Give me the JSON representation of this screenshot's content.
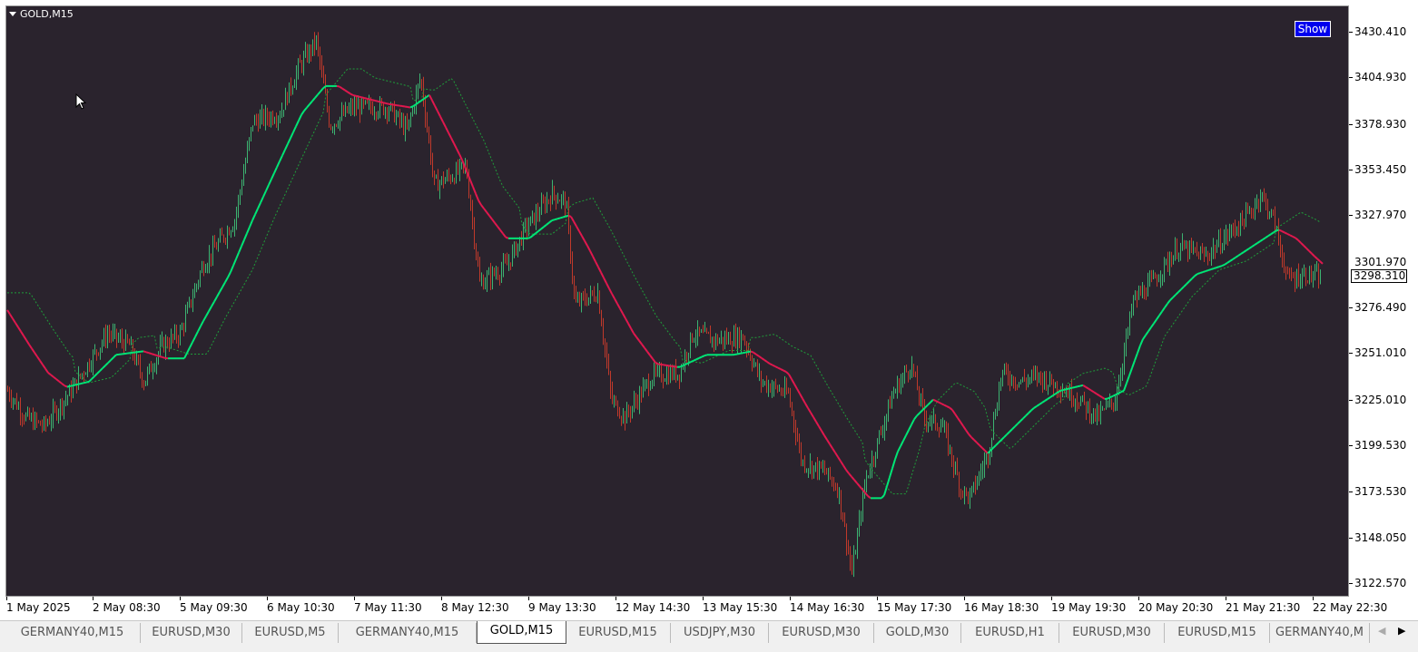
{
  "symbol_title": "GOLD,M15",
  "show_button": "Show",
  "current_price": "3298.310",
  "partial_hidden_label": "3301.970",
  "colors": {
    "background": "#2a232d",
    "bull_candle": "#3cb371",
    "bear_candle": "#c0392b",
    "ma_up": "#00e676",
    "ma_down": "#e0184e",
    "ma_dotted": "#1f9d3a"
  },
  "price_axis": [
    "3430.410",
    "3404.930",
    "3378.930",
    "3353.450",
    "3327.970",
    "3276.490",
    "3251.010",
    "3225.010",
    "3199.530",
    "3173.530",
    "3148.050",
    "3122.570"
  ],
  "time_axis": [
    "1 May 2025",
    "2 May 08:30",
    "5 May 09:30",
    "6 May 10:30",
    "7 May 11:30",
    "8 May 12:30",
    "9 May 13:30",
    "12 May 14:30",
    "13 May 15:30",
    "14 May 16:30",
    "15 May 17:30",
    "16 May 18:30",
    "19 May 19:30",
    "20 May 20:30",
    "21 May 21:30",
    "22 May 22:30"
  ],
  "tabs": [
    "GERMANY40,M15",
    "EURUSD,M30",
    "EURUSD,M5",
    "GERMANY40,M15",
    "GOLD,M15",
    "EURUSD,M15",
    "USDJPY,M30",
    "EURUSD,M30",
    "GOLD,M30",
    "EURUSD,H1",
    "EURUSD,M30",
    "EURUSD,M15",
    "GERMANY40,M"
  ],
  "active_tab": 4,
  "tab_scroll": {
    "left_icon": "scroll-left-icon",
    "right_icon": "scroll-right-icon"
  },
  "chart_data": {
    "type": "candlestick",
    "title": "GOLD,M15",
    "ylim": [
      3115,
      3445
    ],
    "price_path": [
      [
        0,
        3230
      ],
      [
        20,
        3215
      ],
      [
        40,
        3210
      ],
      [
        70,
        3230
      ],
      [
        110,
        3262
      ],
      [
        135,
        3255
      ],
      [
        150,
        3235
      ],
      [
        170,
        3255
      ],
      [
        190,
        3262
      ],
      [
        215,
        3300
      ],
      [
        250,
        3325
      ],
      [
        270,
        3380
      ],
      [
        300,
        3385
      ],
      [
        320,
        3410
      ],
      [
        340,
        3425
      ],
      [
        355,
        3378
      ],
      [
        380,
        3388
      ],
      [
        420,
        3388
      ],
      [
        440,
        3375
      ],
      [
        455,
        3405
      ],
      [
        470,
        3345
      ],
      [
        490,
        3350
      ],
      [
        505,
        3355
      ],
      [
        520,
        3290
      ],
      [
        550,
        3300
      ],
      [
        570,
        3320
      ],
      [
        600,
        3340
      ],
      [
        615,
        3335
      ],
      [
        625,
        3278
      ],
      [
        650,
        3285
      ],
      [
        665,
        3225
      ],
      [
        680,
        3215
      ],
      [
        710,
        3238
      ],
      [
        740,
        3240
      ],
      [
        755,
        3262
      ],
      [
        780,
        3258
      ],
      [
        810,
        3260
      ],
      [
        830,
        3235
      ],
      [
        860,
        3228
      ],
      [
        875,
        3190
      ],
      [
        900,
        3185
      ],
      [
        915,
        3175
      ],
      [
        930,
        3128
      ],
      [
        945,
        3180
      ],
      [
        975,
        3228
      ],
      [
        995,
        3245
      ],
      [
        1010,
        3215
      ],
      [
        1030,
        3210
      ],
      [
        1050,
        3175
      ],
      [
        1060,
        3170
      ],
      [
        1080,
        3195
      ],
      [
        1095,
        3240
      ],
      [
        1115,
        3235
      ],
      [
        1135,
        3238
      ],
      [
        1160,
        3232
      ],
      [
        1180,
        3225
      ],
      [
        1200,
        3215
      ],
      [
        1220,
        3225
      ],
      [
        1240,
        3280
      ],
      [
        1260,
        3290
      ],
      [
        1290,
        3310
      ],
      [
        1320,
        3305
      ],
      [
        1350,
        3320
      ],
      [
        1370,
        3330
      ],
      [
        1380,
        3340
      ],
      [
        1395,
        3325
      ],
      [
        1410,
        3292
      ],
      [
        1430,
        3295
      ],
      [
        1450,
        3292
      ],
      [
        1455,
        3298
      ]
    ],
    "ma_path": [
      [
        0,
        3275
      ],
      [
        25,
        3255
      ],
      [
        45,
        3240
      ],
      [
        65,
        3232
      ],
      [
        90,
        3235
      ],
      [
        120,
        3250
      ],
      [
        150,
        3252
      ],
      [
        175,
        3248
      ],
      [
        195,
        3248
      ],
      [
        215,
        3268
      ],
      [
        245,
        3295
      ],
      [
        270,
        3325
      ],
      [
        300,
        3358
      ],
      [
        325,
        3385
      ],
      [
        350,
        3400
      ],
      [
        365,
        3400
      ],
      [
        380,
        3395
      ],
      [
        420,
        3390
      ],
      [
        445,
        3388
      ],
      [
        465,
        3395
      ],
      [
        480,
        3380
      ],
      [
        500,
        3360
      ],
      [
        520,
        3335
      ],
      [
        550,
        3315
      ],
      [
        575,
        3315
      ],
      [
        600,
        3325
      ],
      [
        620,
        3328
      ],
      [
        640,
        3310
      ],
      [
        665,
        3285
      ],
      [
        690,
        3262
      ],
      [
        715,
        3245
      ],
      [
        740,
        3243
      ],
      [
        770,
        3250
      ],
      [
        800,
        3250
      ],
      [
        820,
        3252
      ],
      [
        840,
        3245
      ],
      [
        860,
        3240
      ],
      [
        880,
        3222
      ],
      [
        900,
        3205
      ],
      [
        925,
        3185
      ],
      [
        950,
        3170
      ],
      [
        965,
        3170
      ],
      [
        980,
        3195
      ],
      [
        1000,
        3215
      ],
      [
        1020,
        3225
      ],
      [
        1040,
        3220
      ],
      [
        1060,
        3205
      ],
      [
        1080,
        3195
      ],
      [
        1100,
        3205
      ],
      [
        1130,
        3220
      ],
      [
        1160,
        3230
      ],
      [
        1185,
        3233
      ],
      [
        1210,
        3225
      ],
      [
        1230,
        3230
      ],
      [
        1250,
        3258
      ],
      [
        1280,
        3280
      ],
      [
        1310,
        3295
      ],
      [
        1340,
        3300
      ],
      [
        1370,
        3310
      ],
      [
        1400,
        3320
      ],
      [
        1420,
        3315
      ],
      [
        1440,
        3305
      ],
      [
        1455,
        3298
      ]
    ]
  }
}
